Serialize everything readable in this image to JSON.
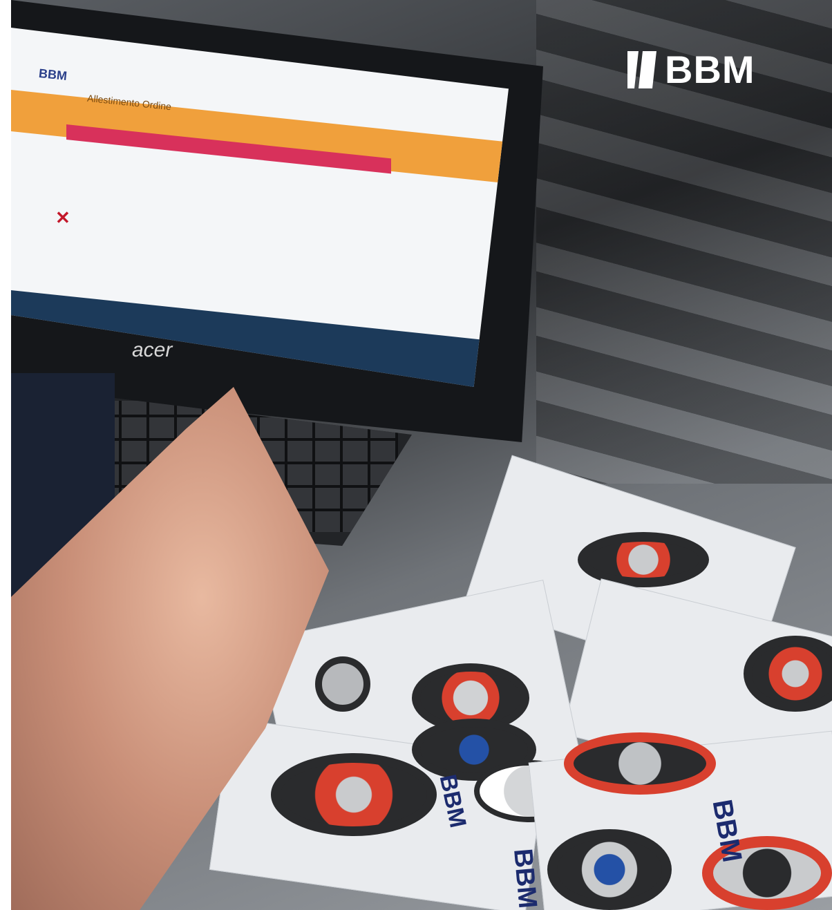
{
  "brand": {
    "logo_text": "BBM"
  },
  "laptop": {
    "brand": "acer",
    "app_logo": "BBM",
    "app_title": "Allestimento Ordine"
  },
  "packages": {
    "label": "BBM"
  },
  "colors": {
    "header_orange": "#f0a03c",
    "alert_red": "#d8315b",
    "brand_blue": "#1c2b6e",
    "seal_red": "#d8402e"
  }
}
